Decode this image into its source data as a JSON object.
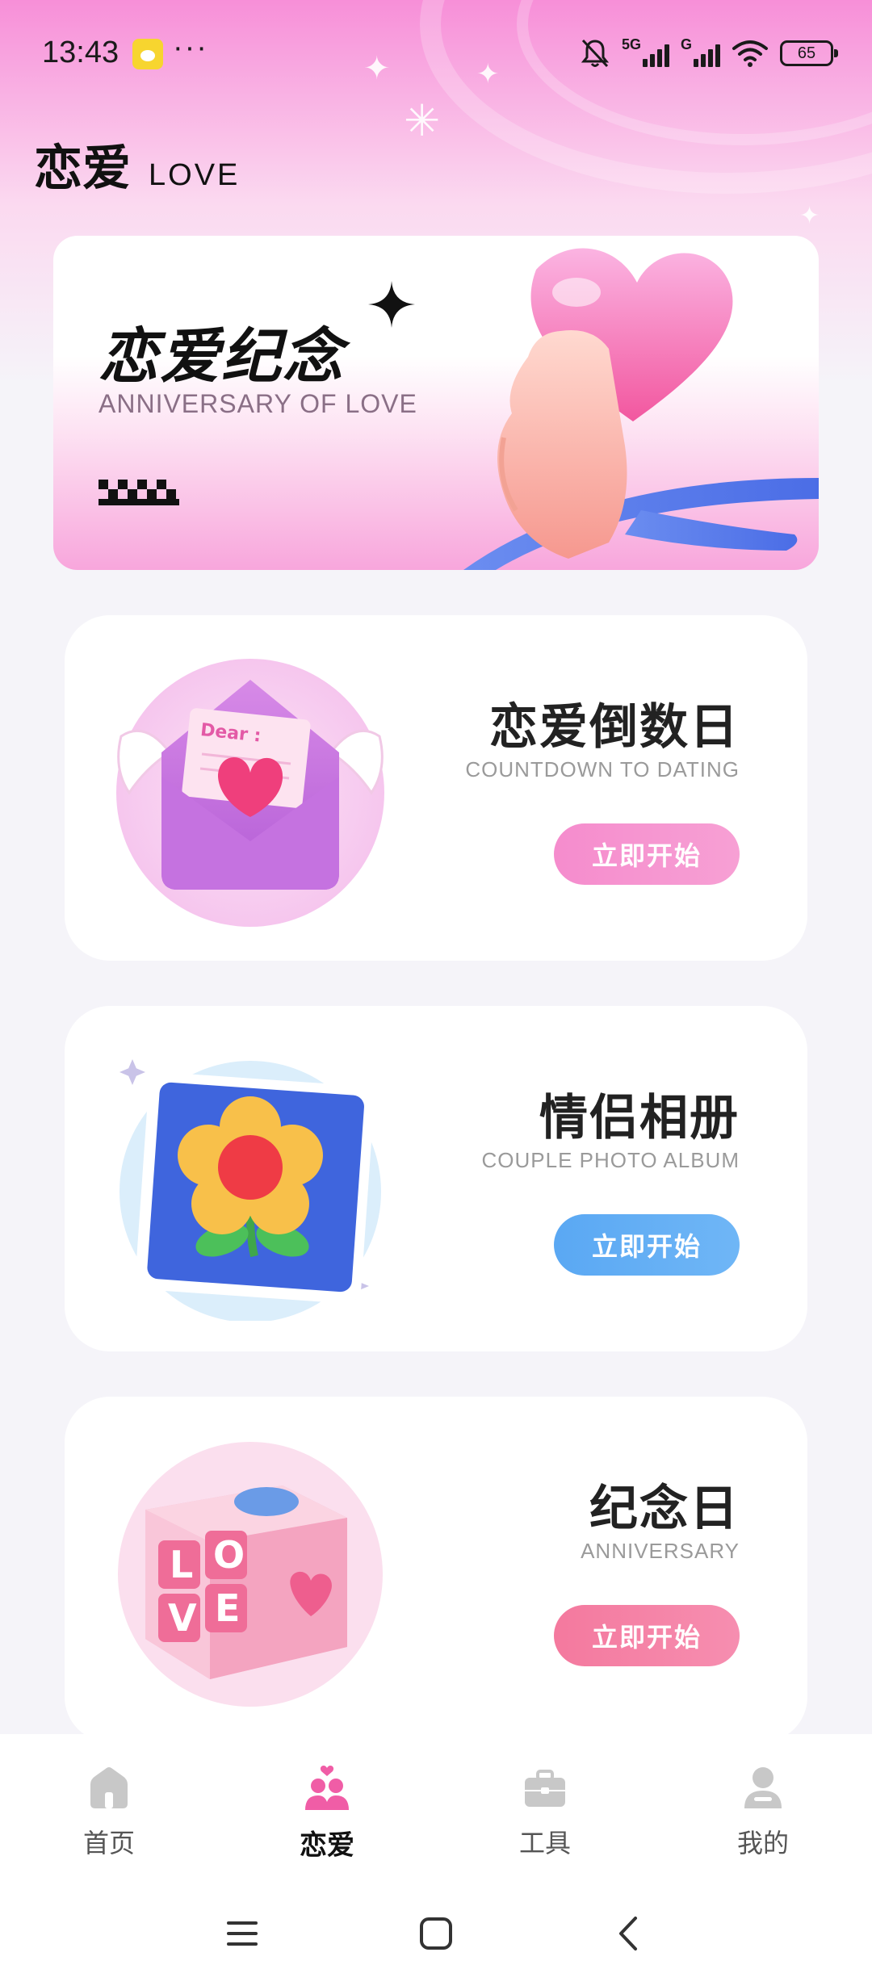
{
  "status_bar": {
    "time": "13:43",
    "more": "···",
    "network_1": "5G",
    "network_2": "G",
    "battery": "65"
  },
  "header": {
    "title": "恋爱",
    "subtitle": "LOVE"
  },
  "hero": {
    "title": "恋爱纪念",
    "subtitle": "ANNIVERSARY OF LOVE"
  },
  "cards": [
    {
      "title": "恋爱倒数日",
      "subtitle": "COUNTDOWN TO DATING",
      "button": "立即开始",
      "accent": "#f58ccd",
      "art_label": "Dear :"
    },
    {
      "title": "情侣相册",
      "subtitle": "COUPLE PHOTO ALBUM",
      "button": "立即开始",
      "accent": "#5aa8f3"
    },
    {
      "title": "纪念日",
      "subtitle": "ANNIVERSARY",
      "button": "立即开始",
      "accent": "#f4799e",
      "art_letters": [
        "L",
        "O",
        "V",
        "E"
      ]
    }
  ],
  "bottom_nav": {
    "items": [
      {
        "label": "首页",
        "icon": "home-icon",
        "active": false
      },
      {
        "label": "恋爱",
        "icon": "couple-icon",
        "active": true
      },
      {
        "label": "工具",
        "icon": "toolbox-icon",
        "active": false
      },
      {
        "label": "我的",
        "icon": "profile-icon",
        "active": false
      }
    ]
  },
  "colors": {
    "brand_pink": "#f78fd8",
    "page_bg": "#f5f4f9"
  }
}
